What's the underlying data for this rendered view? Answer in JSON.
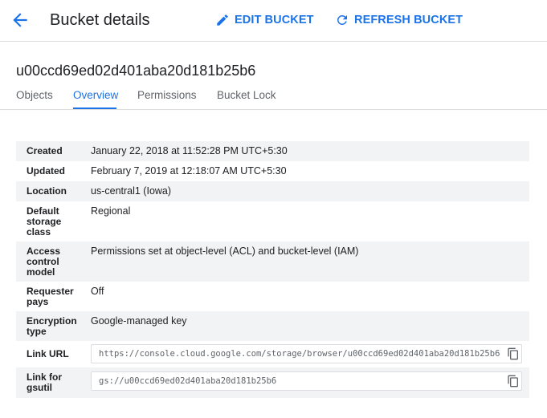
{
  "header": {
    "title": "Bucket details",
    "edit_label": "EDIT BUCKET",
    "refresh_label": "REFRESH BUCKET"
  },
  "bucket": {
    "name": "u00ccd69ed02d401aba20d181b25b6"
  },
  "tabs": [
    {
      "label": "Objects"
    },
    {
      "label": "Overview"
    },
    {
      "label": "Permissions"
    },
    {
      "label": "Bucket Lock"
    }
  ],
  "active_tab": "Overview",
  "details": {
    "created": {
      "label": "Created",
      "value": "January 22, 2018 at 11:52:28 PM UTC+5:30"
    },
    "updated": {
      "label": "Updated",
      "value": "February 7, 2019 at 12:18:07 AM UTC+5:30"
    },
    "location": {
      "label": "Location",
      "value": "us-central1 (Iowa)"
    },
    "storage_class": {
      "label": "Default storage class",
      "value": "Regional"
    },
    "access_control": {
      "label": "Access control model",
      "value": "Permissions set at object-level (ACL) and bucket-level (IAM)"
    },
    "requester_pays": {
      "label": "Requester pays",
      "value": "Off"
    },
    "encryption": {
      "label": "Encryption type",
      "value": "Google-managed key"
    },
    "link_url": {
      "label": "Link URL",
      "value": "https://console.cloud.google.com/storage/browser/u00ccd69ed02d401aba20d181b25b6"
    },
    "link_gsutil": {
      "label": "Link for gsutil",
      "value": "gs://u00ccd69ed02d401aba20d181b25b6"
    }
  },
  "colors": {
    "accent": "#1a73e8",
    "row_shade": "#f1f3f4",
    "divider": "#dadce0"
  },
  "icons": {
    "back": "arrow-back-icon",
    "edit": "pencil-icon",
    "refresh": "refresh-icon",
    "copy": "copy-icon"
  }
}
